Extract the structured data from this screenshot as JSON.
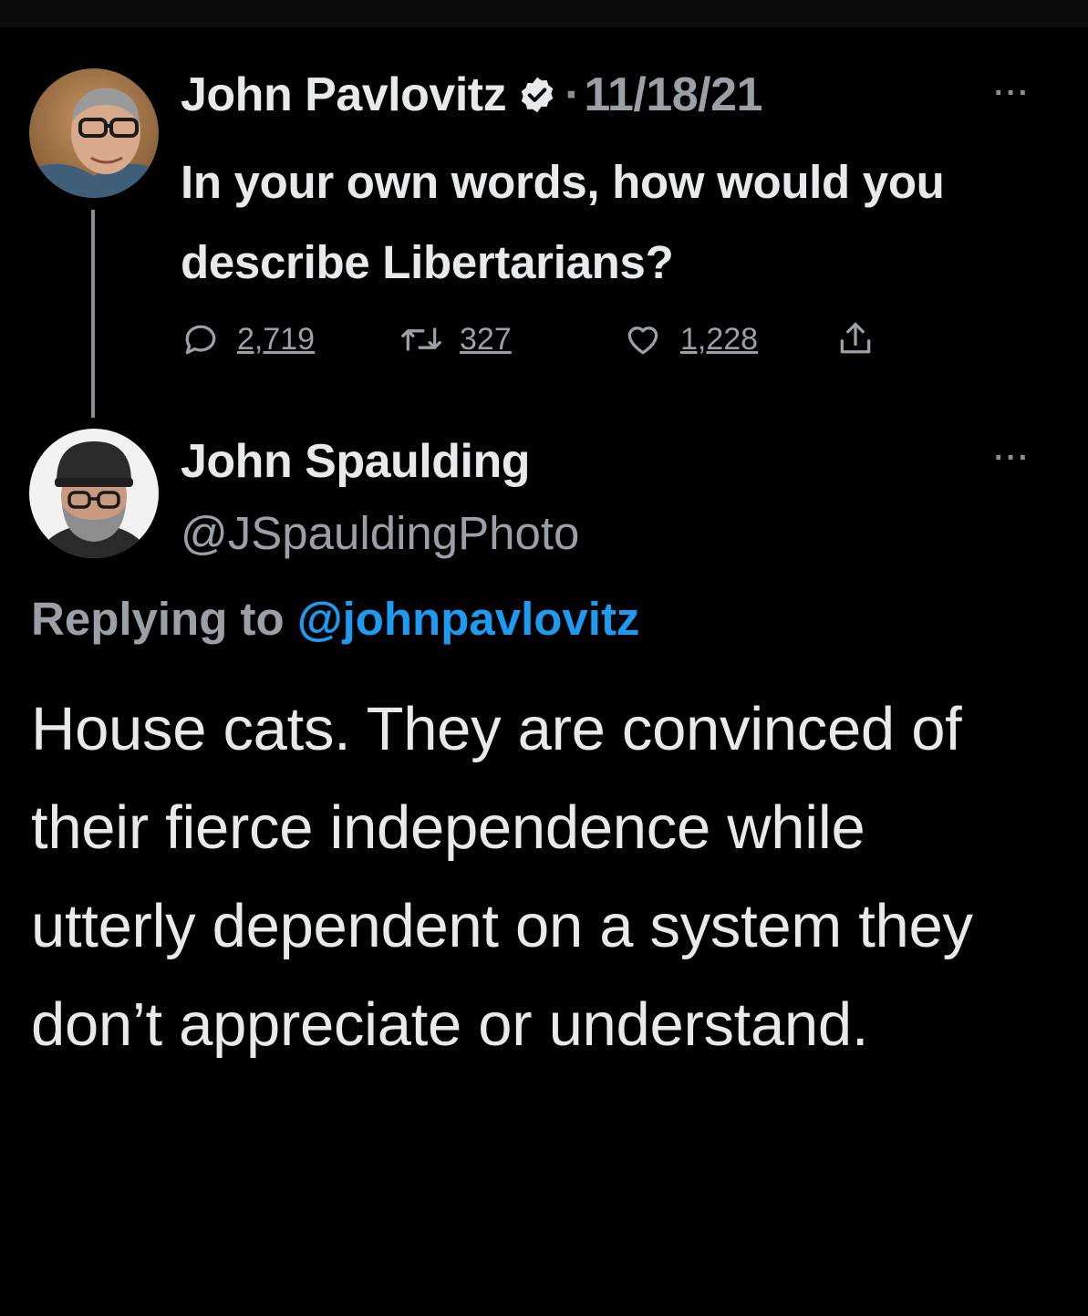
{
  "colors": {
    "background": "#000000",
    "primary_text": "#e7e9ea",
    "secondary_text": "#9aa0a6",
    "link": "#1d9bf0",
    "thread_line": "#8a8d91"
  },
  "original_tweet": {
    "author_name": "John Pavlovitz",
    "verified_icon": "verified-badge-icon",
    "separator": "·",
    "date": "11/18/21",
    "more_icon": "more-dots-icon",
    "more_label": "···",
    "text": "In your own words, how would you describe Libertarians?",
    "actions": {
      "reply": {
        "icon": "reply-bubble-icon",
        "count": "2,719"
      },
      "retweet": {
        "icon": "retweet-icon",
        "count": "327"
      },
      "like": {
        "icon": "heart-icon",
        "count": "1,228"
      },
      "share": {
        "icon": "share-icon"
      }
    }
  },
  "reply_tweet": {
    "author_name": "John Spaulding",
    "handle": "@JSpauldingPhoto",
    "more_icon": "more-dots-icon",
    "more_label": "···",
    "replying_prefix": "Replying to",
    "replying_handle": "@johnpavlovitz",
    "text": "House cats. They are convinced of their fierce independence while utterly dependent on a system they don’t appreciate or understand."
  }
}
